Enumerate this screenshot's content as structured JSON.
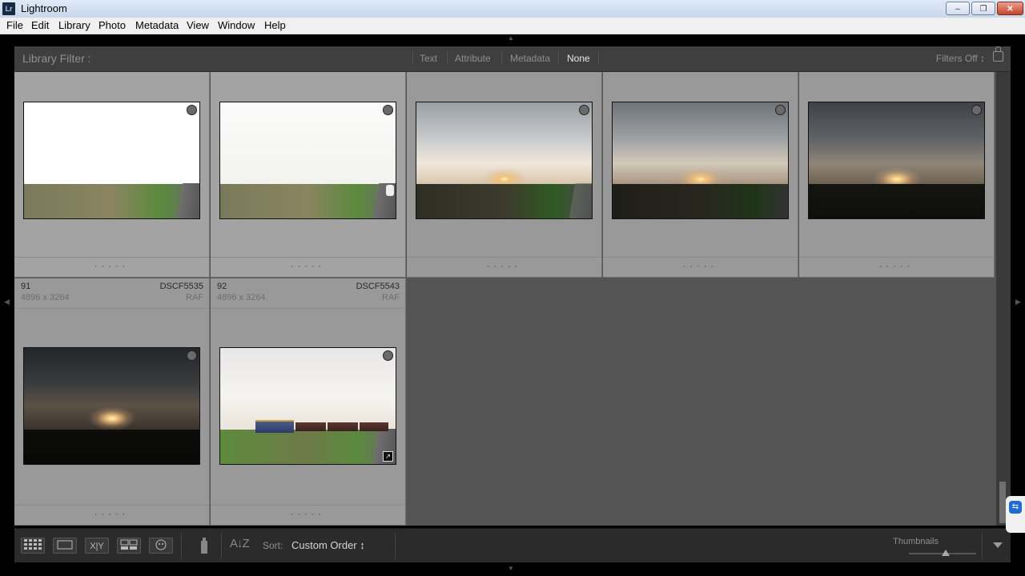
{
  "window": {
    "app_icon": "Lr",
    "title": "Lightroom",
    "minimize_icon": "–",
    "restore_icon": "❐",
    "close_icon": "✕"
  },
  "menu": {
    "items": [
      "File",
      "Edit",
      "Library",
      "Photo",
      "Metadata",
      "View",
      "Window",
      "Help"
    ]
  },
  "filter_bar": {
    "label": "Library Filter :",
    "options": [
      "Text",
      "Attribute",
      "Metadata",
      "None"
    ],
    "active_option": "None",
    "filters_off": "Filters Off ↕"
  },
  "grid": {
    "cells": [
      {
        "index": "",
        "filename": "",
        "dimensions": "",
        "filetype": "",
        "scene": "bright-field",
        "rating_dots": "·····"
      },
      {
        "index": "",
        "filename": "",
        "dimensions": "",
        "filetype": "",
        "scene": "bright-field-car",
        "rating_dots": "·····"
      },
      {
        "index": "",
        "filename": "",
        "dimensions": "",
        "filetype": "",
        "scene": "sunset-light",
        "rating_dots": "·····"
      },
      {
        "index": "",
        "filename": "",
        "dimensions": "",
        "filetype": "",
        "scene": "sunset-mid",
        "rating_dots": "·····"
      },
      {
        "index": "",
        "filename": "",
        "dimensions": "",
        "filetype": "",
        "scene": "sunset-dark",
        "rating_dots": "·····"
      },
      {
        "index": "91",
        "filename": "DSCF5535",
        "dimensions": "4896 x 3264",
        "filetype": "RAF",
        "scene": "sunset-darkest",
        "rating_dots": "·····"
      },
      {
        "index": "92",
        "filename": "DSCF5543",
        "dimensions": "4896 x 3264",
        "filetype": "RAF",
        "scene": "train",
        "rating_dots": "·····",
        "edit_icon": "↗"
      }
    ]
  },
  "toolbar": {
    "grid_view_icon": "grid-view-icon",
    "loupe_view_icon": "loupe-view-icon",
    "compare_view_label": "X|Y",
    "survey_view_icon": "survey-view-icon",
    "people_view_icon": "people-view-icon",
    "spray_can_icon": "painter-icon",
    "sort_direction_label": "A↓Z",
    "sort_label": "Sort:",
    "sort_value": "Custom Order ↕",
    "thumbnails_label": "Thumbnails",
    "thumbnail_size": 0.55
  },
  "colors": {
    "grid_bg": "#545454",
    "cell_bg": "#999999",
    "active_filter": "#e8e8e8"
  }
}
